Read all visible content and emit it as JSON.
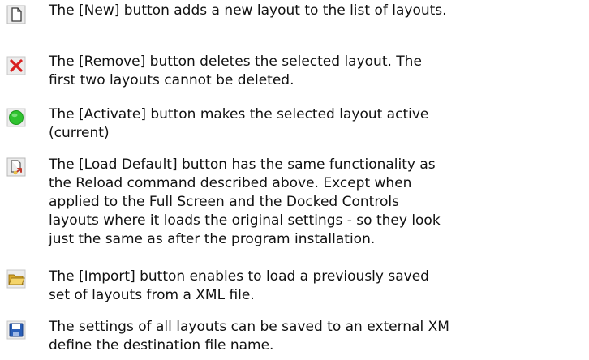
{
  "items": [
    {
      "icon": "new-page-icon",
      "lines": [
        "The [New] button adds a new layout to the list of layouts."
      ]
    },
    {
      "icon": "remove-x-icon",
      "lines": [
        "The [Remove] button deletes the selected layout. The",
        "first two layouts cannot be deleted."
      ]
    },
    {
      "icon": "activate-green-circle-icon",
      "lines": [
        "The [Activate] button makes the selected layout active",
        "(current)"
      ]
    },
    {
      "icon": "load-default-icon",
      "lines": [
        "The [Load Default] button has the same functionality as",
        "the Reload command described above. Except when",
        "applied to the Full Screen and the Docked Controls",
        "layouts where it loads the original settings - so they look",
        "just the same as after the program installation."
      ]
    },
    {
      "icon": "import-folder-icon",
      "lines": [
        "The [Import] button enables to load a previously saved",
        "set of layouts from a XML file."
      ]
    },
    {
      "icon": "save-floppy-icon",
      "lines": [
        "The settings of all layouts can be saved to an external XM",
        "define the destination file name."
      ]
    }
  ],
  "colors": {
    "remove": "#d92020",
    "activate": "#2fc22f",
    "save": "#2a5fb8",
    "folder": "#e8c14a"
  }
}
